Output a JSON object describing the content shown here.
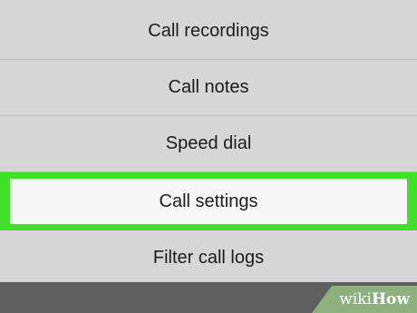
{
  "menu": {
    "items": [
      {
        "label": "Call recordings"
      },
      {
        "label": "Call notes"
      },
      {
        "label": "Speed dial"
      },
      {
        "label": "Call settings",
        "highlighted": true
      },
      {
        "label": "Filter call logs"
      }
    ]
  },
  "watermark": {
    "wiki": "wiki",
    "how": "How"
  },
  "colors": {
    "background": "#d4d4d4",
    "highlight": "#3fe027",
    "highlight_inner": "#f7f7f7",
    "bottom_bar": "#5f5f5f"
  }
}
